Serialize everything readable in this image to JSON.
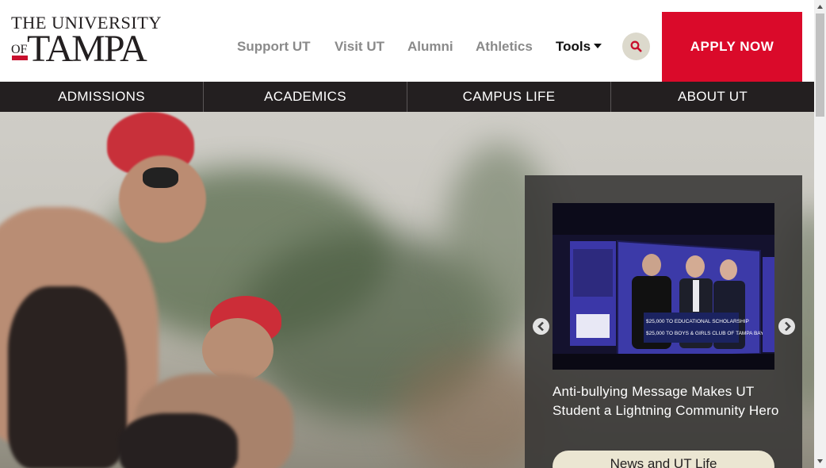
{
  "logo": {
    "top_text": "THE UNIVERSITY",
    "of_text": "OF",
    "main_text": "TAMPA"
  },
  "utility_nav": {
    "links": [
      "Support UT",
      "Visit UT",
      "Alumni",
      "Athletics"
    ],
    "tools_label": "Tools"
  },
  "search": {
    "icon": "search-icon"
  },
  "apply": {
    "label": "APPLY NOW",
    "color": "#da0a2a"
  },
  "main_nav": {
    "items": [
      "ADMISSIONS",
      "ACADEMICS",
      "CAMPUS LIFE",
      "ABOUT UT"
    ]
  },
  "news": {
    "title": "Anti-bullying Message Makes UT Student a Lightning Community Hero",
    "button_label": "News and UT Life",
    "image_lines": [
      "$25,000 TO EDUCATIONAL SCHOLARSHIP",
      "$25,000 TO BOYS & GIRLS CLUB OF TAMPA BAY"
    ]
  },
  "colors": {
    "brand_red": "#c8102e",
    "nav_bg": "#231f20",
    "button_cream": "#ebe6d2"
  }
}
